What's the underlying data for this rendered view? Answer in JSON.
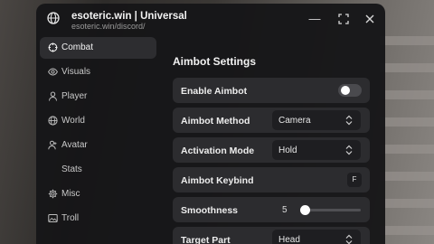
{
  "window": {
    "title": "esoteric.win | Universal",
    "subtitle": "esoteric.win/discord/",
    "logo_icon": "globe-icon",
    "controls": [
      "minimize-icon",
      "maximize-icon",
      "close-icon"
    ]
  },
  "sidebar": {
    "items": [
      {
        "label": "Combat",
        "icon": "crosshair-icon",
        "active": true
      },
      {
        "label": "Visuals",
        "icon": "eye-icon",
        "active": false
      },
      {
        "label": "Player",
        "icon": "person-icon",
        "active": false
      },
      {
        "label": "World",
        "icon": "globe-icon",
        "active": false
      },
      {
        "label": "Avatar",
        "icon": "avatar-icon",
        "active": false
      },
      {
        "label": "Stats",
        "icon": "",
        "active": false
      },
      {
        "label": "Misc",
        "icon": "gear-icon",
        "active": false
      },
      {
        "label": "Troll",
        "icon": "image-icon",
        "active": false
      }
    ]
  },
  "main": {
    "section_title": "Aimbot Settings",
    "enable_aimbot": {
      "label": "Enable Aimbot",
      "enabled": false
    },
    "aimbot_method": {
      "label": "Aimbot Method",
      "value": "Camera"
    },
    "activation_mode": {
      "label": "Activation Mode",
      "value": "Hold"
    },
    "aimbot_keybind": {
      "label": "Aimbot Keybind",
      "key": "F"
    },
    "smoothness": {
      "label": "Smoothness",
      "value": "5",
      "fraction": 0.0
    },
    "target_part": {
      "label": "Target Part",
      "value": "Head"
    }
  },
  "colors": {
    "window_bg": "#161618",
    "row_bg": "#2c2c2f",
    "active_nav_bg": "#2d2d30",
    "text": "#ededed",
    "muted_text": "#9a9a9a"
  }
}
